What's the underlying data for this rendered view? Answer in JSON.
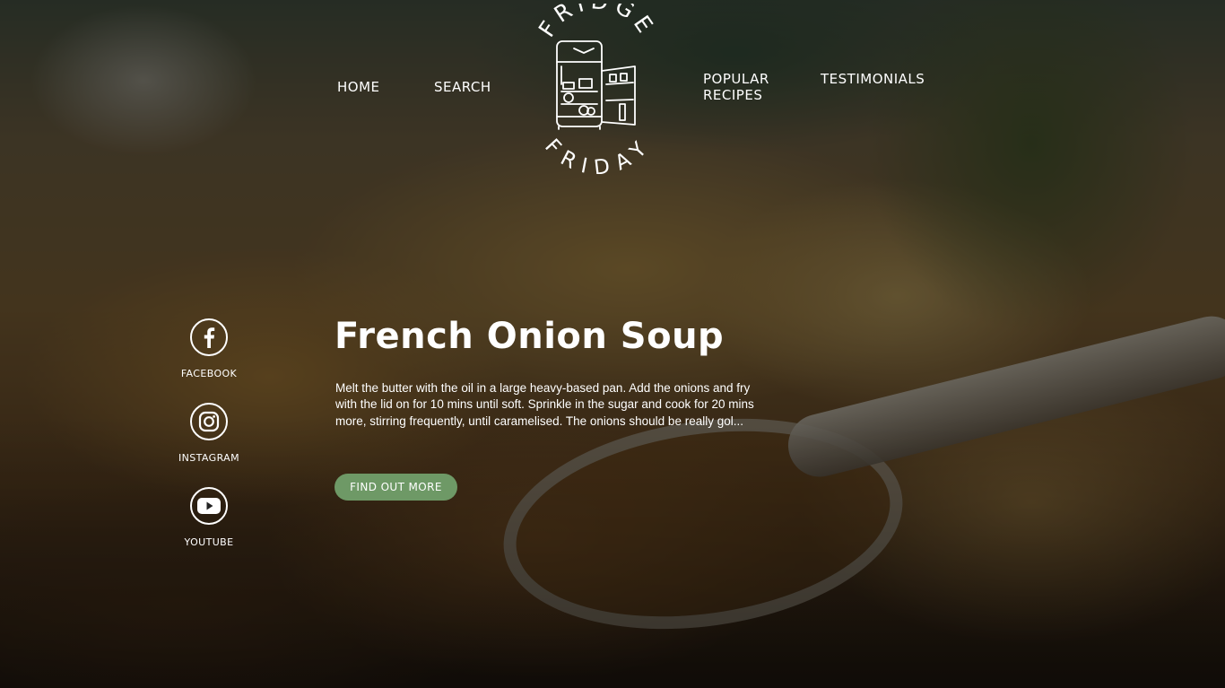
{
  "nav": {
    "home": "HOME",
    "search": "SEARCH",
    "popular_recipes": "POPULAR RECIPES",
    "testimonials": "TESTIMONIALS"
  },
  "logo": {
    "top_text": "FRIDGE",
    "bottom_text": "FRIDAY",
    "icon": "open-fridge-icon"
  },
  "social": [
    {
      "label": "FACEBOOK",
      "icon": "facebook-icon"
    },
    {
      "label": "INSTAGRAM",
      "icon": "instagram-icon"
    },
    {
      "label": "YOUTUBE",
      "icon": "youtube-icon"
    }
  ],
  "hero": {
    "title": "French Onion Soup",
    "description": "Melt the butter with the oil in a large heavy-based pan. Add the onions and fry with the lid on for 10 mins until soft. Sprinkle in the sugar and cook for 20 mins more, stirring frequently, until caramelised. The onions should be really gol...",
    "cta_label": "FIND OUT MORE",
    "background_image": "french-onion-soup-photo"
  },
  "colors": {
    "accent": "#6e9966",
    "text": "#ffffff",
    "overlay": "#0a0806"
  }
}
